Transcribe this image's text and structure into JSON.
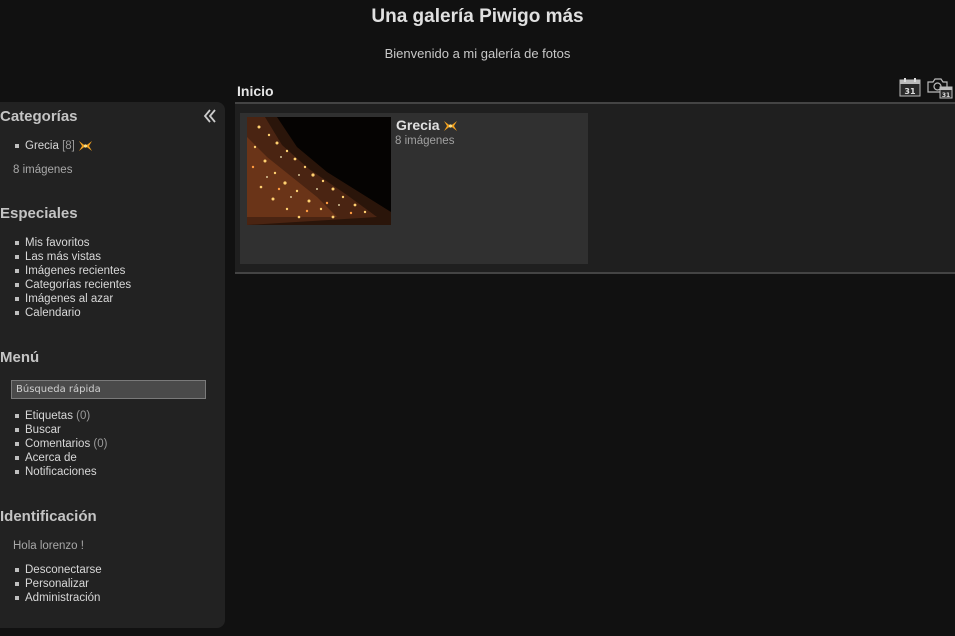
{
  "header": {
    "title": "Una galería Piwigo más",
    "subtitle": "Bienvenido a mi galería de fotos"
  },
  "breadcrumb": "Inicio",
  "toolbar": {
    "icons": [
      "calendar-created-icon",
      "calendar-posted-icon"
    ],
    "calendar_day": "31"
  },
  "sidebar": {
    "categories": {
      "title": "Categorías",
      "items": [
        {
          "label": "Grecia",
          "count": "[8]"
        }
      ],
      "total": "8 imágenes"
    },
    "specials": {
      "title": "Especiales",
      "items": [
        "Mis favoritos",
        "Las más vistas",
        "Imágenes recientes",
        "Categorías recientes",
        "Imágenes al azar",
        "Calendario"
      ]
    },
    "menu": {
      "title": "Menú",
      "search_placeholder": "Búsqueda rápida",
      "items": [
        {
          "label": "Etiquetas",
          "count": "(0)"
        },
        {
          "label": "Buscar",
          "count": ""
        },
        {
          "label": "Comentarios",
          "count": "(0)"
        },
        {
          "label": "Acerca de",
          "count": ""
        },
        {
          "label": "Notificaciones",
          "count": ""
        }
      ]
    },
    "identification": {
      "title": "Identificación",
      "greeting": "Hola lorenzo !",
      "items": [
        "Desconectarse",
        "Personalizar",
        "Administración"
      ]
    }
  },
  "content": {
    "category": {
      "name": "Grecia",
      "count": "8 imágenes"
    }
  },
  "colors": {
    "background": "#111111",
    "sidebar": "#222222",
    "card": "#303030",
    "new_badge": "#f0a020"
  }
}
